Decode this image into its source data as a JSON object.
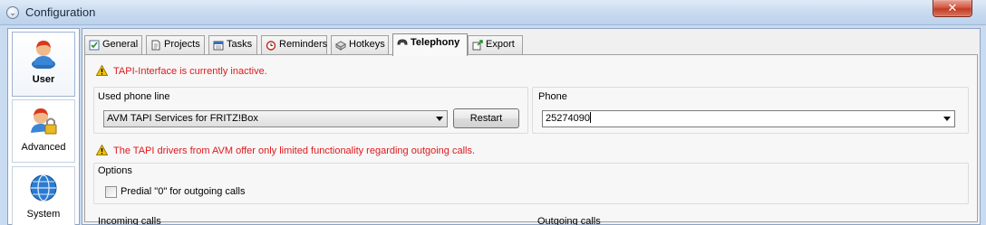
{
  "window": {
    "title": "Configuration",
    "close_glyph": "✕"
  },
  "nav": {
    "items": [
      {
        "label": "User",
        "icon": "user-icon",
        "active": true
      },
      {
        "label": "Advanced",
        "icon": "user-lock-icon",
        "active": false
      },
      {
        "label": "System",
        "icon": "globe-icon",
        "active": false
      }
    ]
  },
  "tabs": [
    {
      "label": "General",
      "icon": "checklist-icon"
    },
    {
      "label": "Projects",
      "icon": "document-icon"
    },
    {
      "label": "Tasks",
      "icon": "calendar-icon"
    },
    {
      "label": "Reminders",
      "icon": "alarm-clock-icon"
    },
    {
      "label": "Hotkeys",
      "icon": "keyboard-icon"
    },
    {
      "label": "Telephony",
      "icon": "phone-icon",
      "active": true
    },
    {
      "label": "Export",
      "icon": "export-icon"
    }
  ],
  "telephony": {
    "inactive_warning": "TAPI-Interface is currently inactive.",
    "used_phone_line_label": "Used phone line",
    "phone_line_value": "AVM TAPI Services for FRITZ!Box",
    "restart_label": "Restart",
    "phone_label": "Phone",
    "phone_value": "25274090",
    "drivers_warning": "The TAPI drivers from AVM offer only limited functionality regarding outgoing calls.",
    "options_label": "Options",
    "predial_label": "Predial \"0\" for outgoing calls",
    "predial_checked": false,
    "incoming_label": "Incoming calls",
    "outgoing_label": "Outgoing calls"
  },
  "colors": {
    "warning_text": "#e0191d",
    "warning_icon": "#f5c400",
    "accent": "#c9dbf0"
  }
}
